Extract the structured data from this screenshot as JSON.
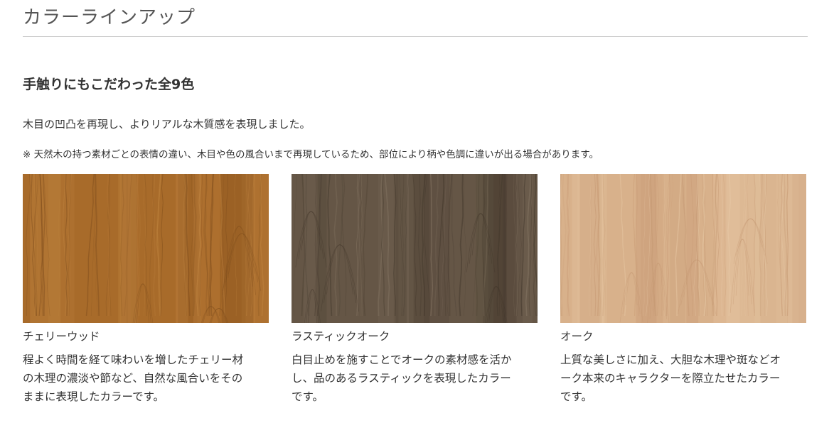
{
  "section": {
    "title": "カラーラインアップ"
  },
  "headline": "手触りにもこだわった全9色",
  "lead": "木目の凹凸を再現し、よりリアルな木質感を表現しました。",
  "note": "※ 天然木の持つ素材ごとの表情の違い、木目や色の風合いまで再現しているため、部位により柄や色調に違いが出る場合があります。",
  "colors": [
    {
      "name": "チェリーウッド",
      "description": "程よく時間を経て味わいを増したチェリー材\nの木理の濃淡や節など、自然な風合いをその\nままに表現したカラーです。",
      "base": "#a86b2a",
      "dark": "#7d4c1c",
      "light": "#c58a45"
    },
    {
      "name": "ラスティックオーク",
      "description": "白目止めを施すことでオークの素材感を活か\nし、品のあるラスティックを表現したカラー\nです。",
      "base": "#655646",
      "dark": "#3f3529",
      "light": "#8b7c69"
    },
    {
      "name": "オーク",
      "description": "上質な美しさに加え、大胆な木理や斑などオ\nーク本来のキャラクターを際立たせたカラー\nです。",
      "base": "#d8b18b",
      "dark": "#c49670",
      "light": "#e8c9a7"
    }
  ]
}
